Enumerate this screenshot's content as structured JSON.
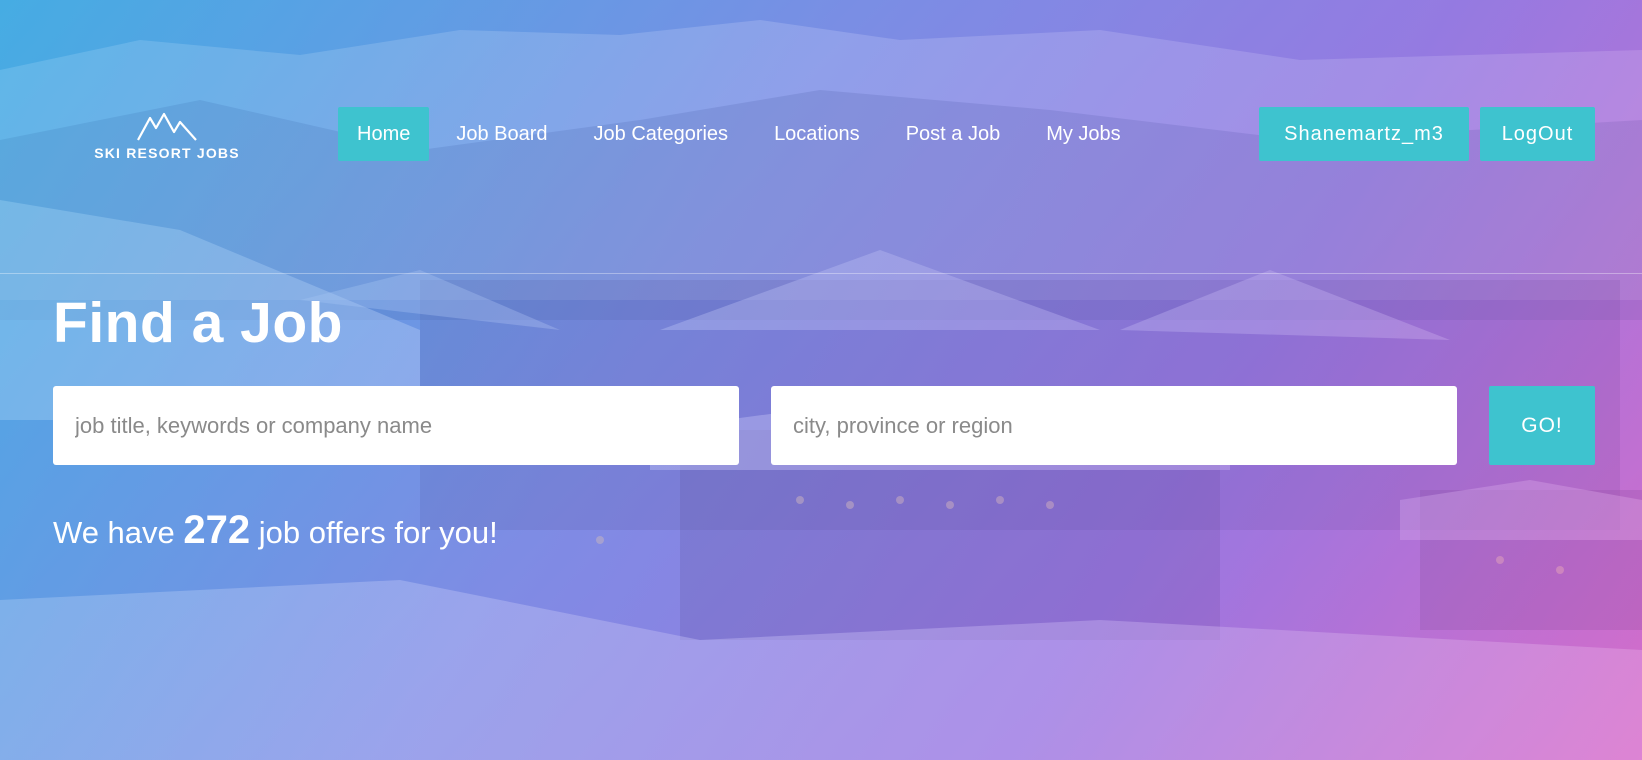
{
  "brand": {
    "name": "SKI RESORT JOBS",
    "logo_icon": "mountain-icon"
  },
  "nav": {
    "items": [
      {
        "label": "Home",
        "active": true
      },
      {
        "label": "Job Board",
        "active": false
      },
      {
        "label": "Job Categories",
        "active": false
      },
      {
        "label": "Locations",
        "active": false
      },
      {
        "label": "Post a Job",
        "active": false
      },
      {
        "label": "My Jobs",
        "active": false
      }
    ]
  },
  "account": {
    "username": "Shanemartz_m3",
    "logout_label": "LogOut"
  },
  "search": {
    "title": "Find a Job",
    "keyword_placeholder": "job title, keywords or company name",
    "location_placeholder": "city, province or region",
    "go_label": "GO!"
  },
  "offers": {
    "prefix": "We have",
    "count": "272",
    "suffix": "job offers for you!"
  },
  "colors": {
    "accent": "#3ec3cf",
    "gradient_start": "#48aae1",
    "gradient_end": "#d76ec8"
  }
}
